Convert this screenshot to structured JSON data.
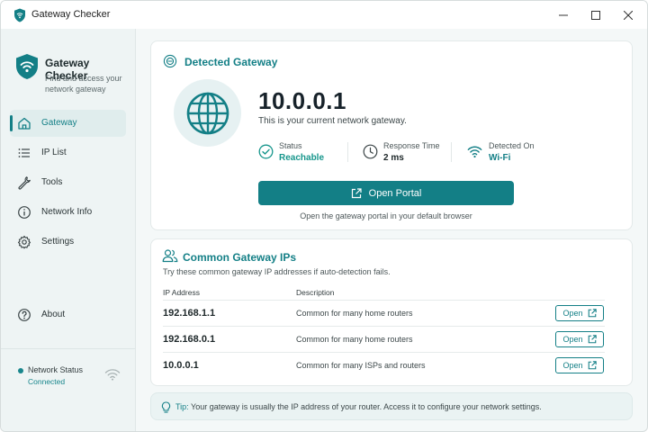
{
  "window": {
    "title": "Gateway Checker",
    "controls": [
      "minimize-icon",
      "maximize-icon",
      "close-icon"
    ]
  },
  "colors": {
    "accent": "#137f86",
    "status_ok": "#17968c",
    "sidebar_bg": "#eef4f4",
    "window_bg": "#f4f8f8"
  },
  "sidebar": {
    "app_name": "Gateway Checker",
    "tagline": "Find and access your network gateway",
    "items": [
      {
        "label": "Gateway",
        "icon": "home-icon",
        "active": true
      },
      {
        "label": "IP List",
        "icon": "list-icon",
        "active": false
      },
      {
        "label": "Tools",
        "icon": "wrench-icon",
        "active": false
      },
      {
        "label": "Network Info",
        "icon": "info-icon",
        "active": false
      },
      {
        "label": "Settings",
        "icon": "gear-icon",
        "active": false
      },
      {
        "label": "About",
        "icon": "help-icon",
        "active": false
      }
    ],
    "network_status": {
      "title": "Network Status",
      "status": "Connected",
      "icon": "wifi-icon"
    }
  },
  "detected": {
    "title": "Detected Gateway",
    "ip": "10.0.0.1",
    "description": "This is your current network gateway.",
    "stats": [
      {
        "label": "Status",
        "value": "Reachable",
        "icon": "check-circle-icon"
      },
      {
        "label": "Response Time",
        "value": "2 ms",
        "icon": "clock-icon"
      },
      {
        "label": "Detected On",
        "value": "Wi-Fi",
        "icon": "wifi-icon"
      }
    ],
    "button_label": "Open Portal",
    "hint": "Open the gateway portal in your default browser"
  },
  "common": {
    "title": "Common Gateway IPs",
    "subtitle": "Try these common gateway IP addresses if auto-detection fails.",
    "columns": [
      "IP Address",
      "Description"
    ],
    "rows": [
      {
        "ip": "192.168.1.1",
        "description": "Common for many home routers",
        "action": "Open"
      },
      {
        "ip": "192.168.0.1",
        "description": "Common for many home routers",
        "action": "Open"
      },
      {
        "ip": "10.0.0.1",
        "description": "Common for many ISPs and routers",
        "action": "Open"
      }
    ]
  },
  "tip": {
    "label": "Tip:",
    "text": "Your gateway is usually the IP address of your router. Access it to configure your network settings."
  }
}
